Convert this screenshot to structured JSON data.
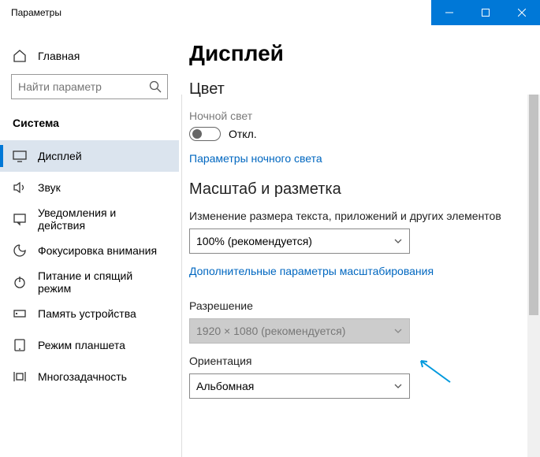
{
  "titlebar": {
    "title": "Параметры"
  },
  "sidebar": {
    "home": "Главная",
    "search_placeholder": "Найти параметр",
    "category": "Система",
    "items": [
      {
        "label": "Дисплей"
      },
      {
        "label": "Звук"
      },
      {
        "label": "Уведомления и действия"
      },
      {
        "label": "Фокусировка внимания"
      },
      {
        "label": "Питание и спящий режим"
      },
      {
        "label": "Память устройства"
      },
      {
        "label": "Режим планшета"
      },
      {
        "label": "Многозадачность"
      }
    ]
  },
  "main": {
    "page_title": "Дисплей",
    "color_section": "Цвет",
    "night_light_label": "Ночной свет",
    "night_light_state": "Откл.",
    "night_light_link": "Параметры ночного света",
    "scale_section": "Масштаб и разметка",
    "scale_field": "Изменение размера текста, приложений и других элементов",
    "scale_value": "100% (рекомендуется)",
    "scale_link": "Дополнительные параметры масштабирования",
    "resolution_field": "Разрешение",
    "resolution_value": "1920 × 1080 (рекомендуется)",
    "orientation_field": "Ориентация",
    "orientation_value": "Альбомная"
  }
}
